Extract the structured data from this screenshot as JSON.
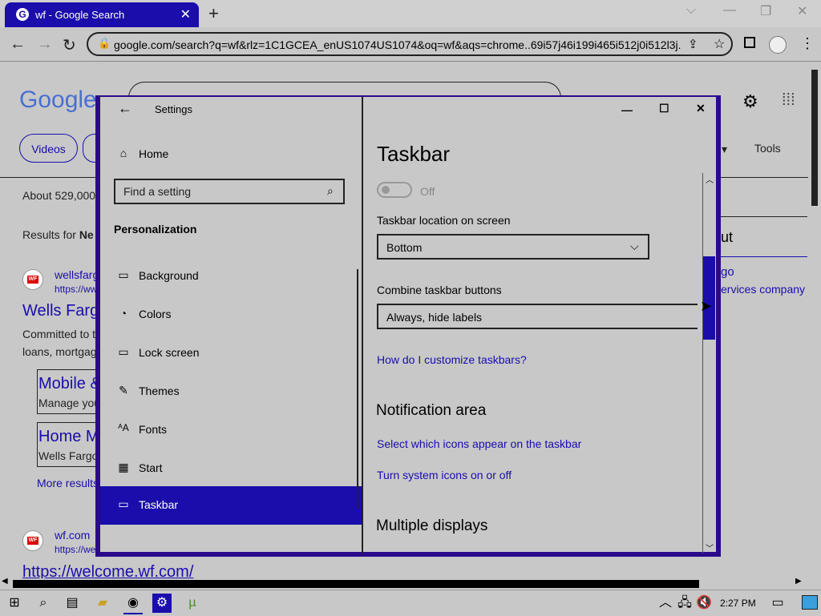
{
  "browser": {
    "tab_title": "wf - Google Search",
    "tab_close": "✕",
    "new_tab": "+",
    "url": "google.com/search?q=wf&rlz=1C1GCEA_enUS1074US1074&oq=wf&aqs=chrome..69i57j46i199i465i512j0i512l3j...",
    "win_dropdown": "⌵",
    "win_min": "—",
    "win_max": "❐",
    "win_close": "✕"
  },
  "google": {
    "logo": "Google",
    "chips": [
      "Videos"
    ],
    "tools": "Tools",
    "results_count": "About 529,000",
    "results_for_prefix": "Results for",
    "results_for_bold": "Ne",
    "result1": {
      "site": "wellsfarg",
      "url": "https://ww",
      "title": "Wells Farg",
      "snippet1": "Committed to t",
      "snippet2": "loans, mortgag",
      "box1_title": "Mobile &",
      "box1_text": "Manage you",
      "box2_title": "Home M",
      "box2_text": "Wells Fargo",
      "more": "More results"
    },
    "result2": {
      "site": "wf.com",
      "url": "https://we",
      "title": "https://welcome.wf.com/"
    },
    "side_panel": {
      "heading": "ut",
      "link1": "go",
      "link2": "ervices company"
    }
  },
  "settings": {
    "title": "Settings",
    "back": "←",
    "min": "—",
    "max": "☐",
    "close": "✕",
    "home_label": "Home",
    "search_placeholder": "Find a setting",
    "section": "Personalization",
    "nav": [
      {
        "label": "Background",
        "icon": "image-icon"
      },
      {
        "label": "Colors",
        "icon": "palette-icon"
      },
      {
        "label": "Lock screen",
        "icon": "lock-screen-icon"
      },
      {
        "label": "Themes",
        "icon": "themes-icon"
      },
      {
        "label": "Fonts",
        "icon": "fonts-icon"
      },
      {
        "label": "Start",
        "icon": "start-icon"
      },
      {
        "label": "Taskbar",
        "icon": "taskbar-icon"
      }
    ],
    "page_title": "Taskbar",
    "toggle_state": "Off",
    "location_label": "Taskbar location on screen",
    "location_value": "Bottom",
    "combine_label": "Combine taskbar buttons",
    "combine_value": "Always, hide labels",
    "customize_link": "How do I customize taskbars?",
    "notification_heading": "Notification area",
    "notif_link1": "Select which icons appear on the taskbar",
    "notif_link2": "Turn system icons on or off",
    "multiple_heading": "Multiple displays"
  },
  "taskbar": {
    "time": "2:27 PM"
  },
  "colors": {
    "accent": "#1a0dab",
    "window_border": "#2a0a8a"
  }
}
